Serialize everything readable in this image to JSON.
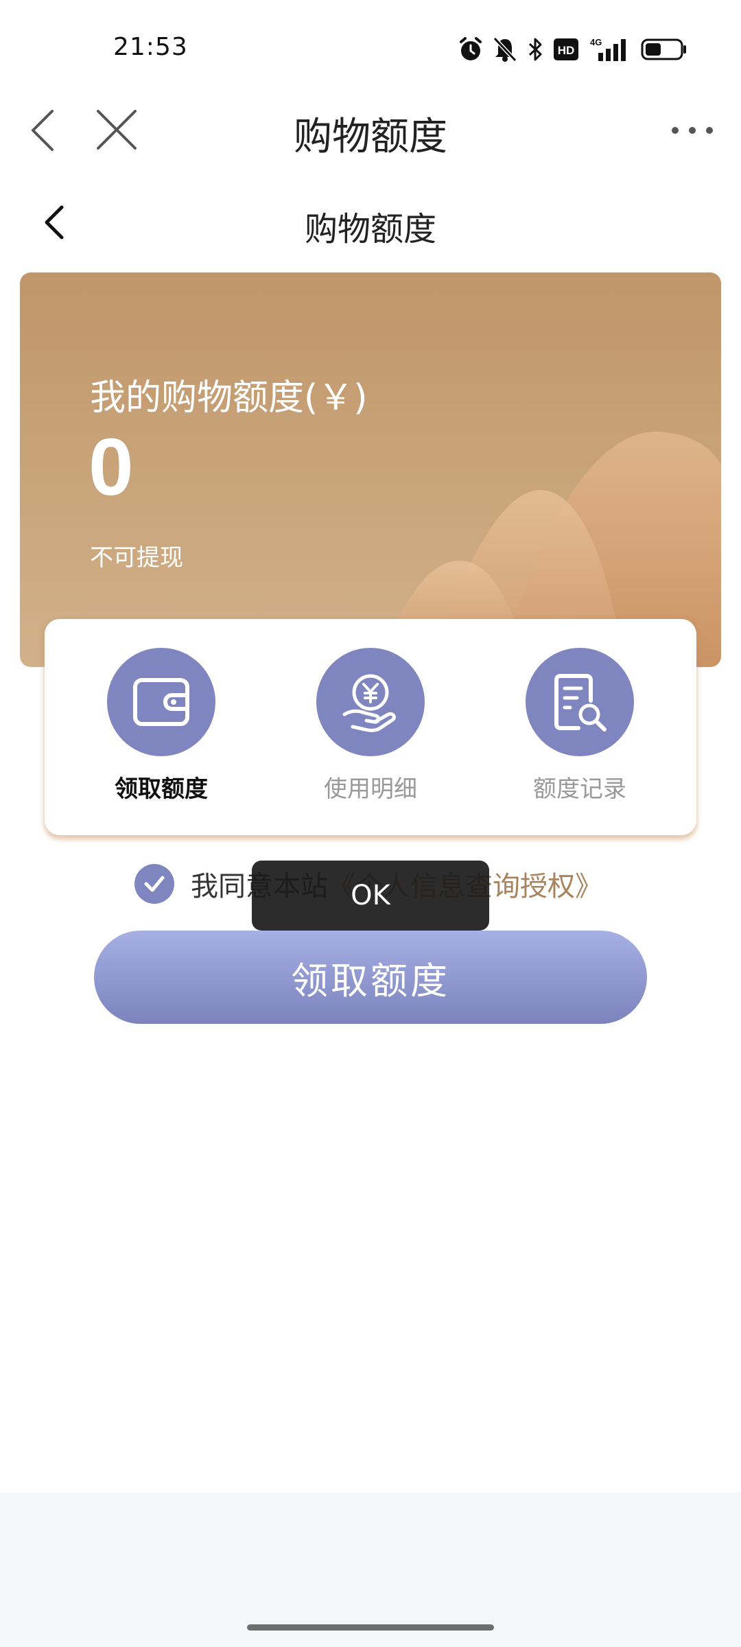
{
  "status_bar": {
    "time": "21:53",
    "icons": [
      "alarm-icon",
      "bell-off-icon",
      "bluetooth-icon",
      "hd-icon",
      "signal-4g-icon",
      "battery-icon"
    ],
    "hd_text": "HD",
    "network": "4G"
  },
  "webview": {
    "title": "购物额度",
    "icons": [
      "back-icon",
      "close-icon",
      "more-icon"
    ]
  },
  "page": {
    "title": "购物额度"
  },
  "banner": {
    "label": "我的购物额度(￥)",
    "amount": "0",
    "note": "不可提现"
  },
  "actions": [
    {
      "label": "领取额度",
      "icon": "wallet-icon",
      "active": true
    },
    {
      "label": "使用明细",
      "icon": "yuan-hand-icon",
      "active": false
    },
    {
      "label": "额度记录",
      "icon": "record-search-icon",
      "active": false
    }
  ],
  "agreement": {
    "checked": true,
    "text": "我同意本站",
    "link": "《个人信息查询授权》"
  },
  "toast": {
    "text": "OK"
  },
  "primary_button": {
    "label": "领取额度"
  },
  "colors": {
    "accent": "#7f86bf",
    "banner": "#c0956a",
    "link": "#a7845d"
  }
}
